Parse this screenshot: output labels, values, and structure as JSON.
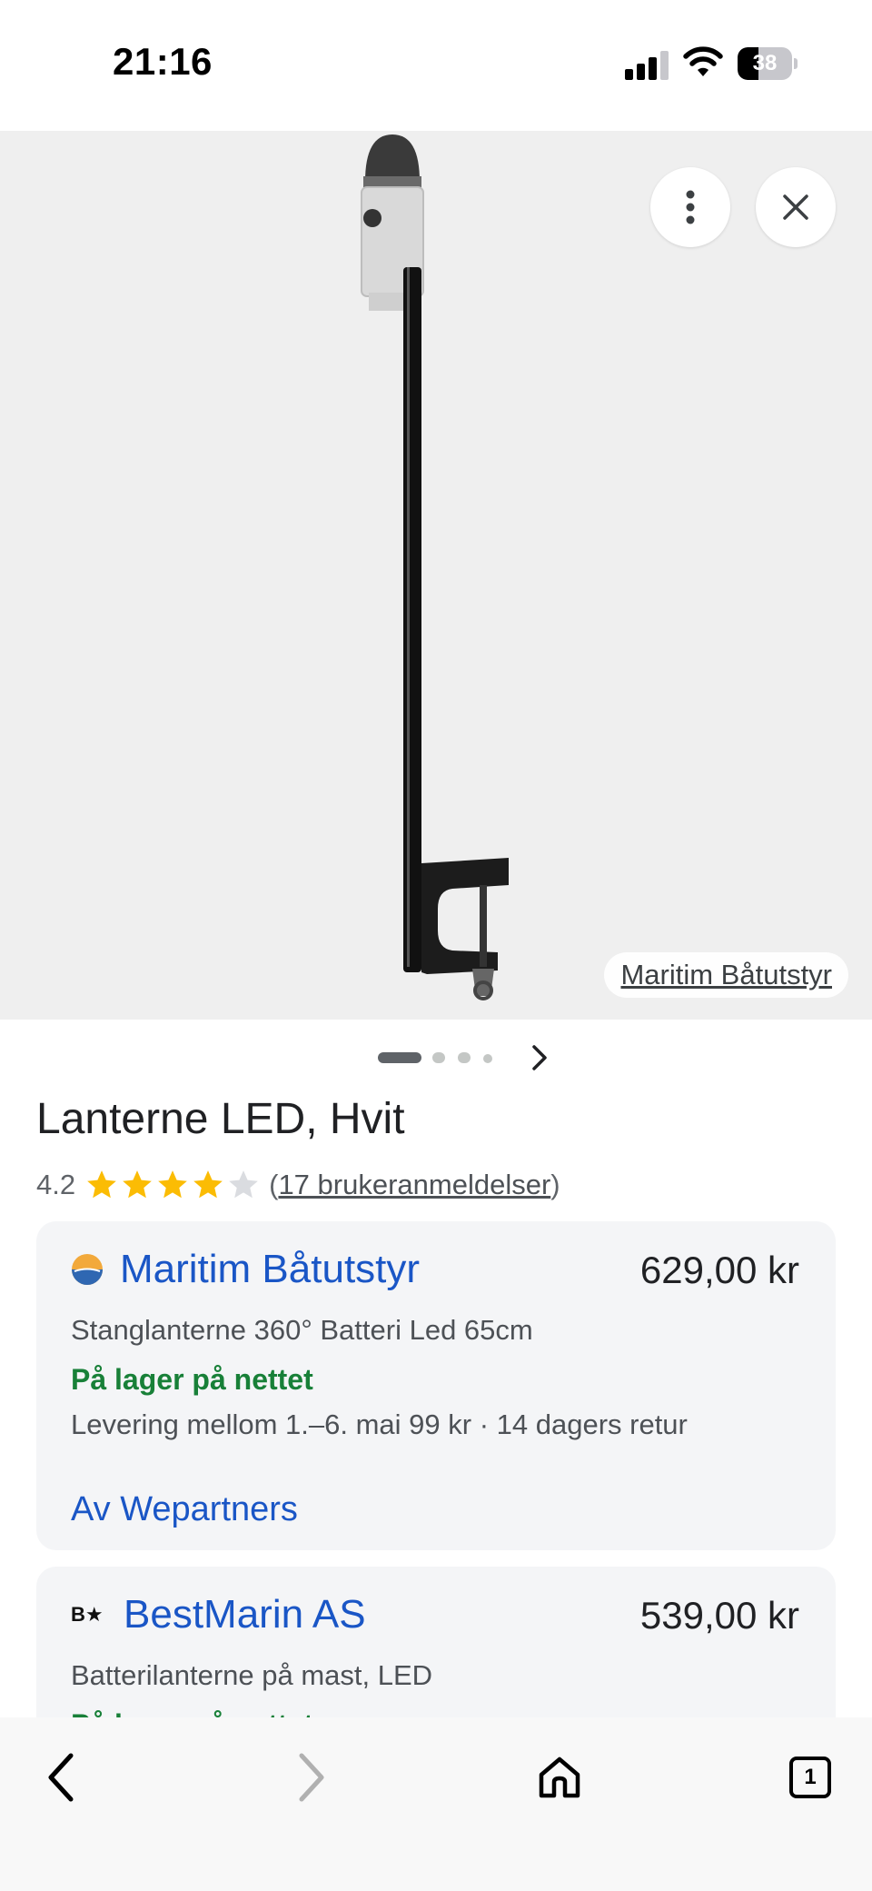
{
  "status_bar": {
    "time": "21:16",
    "battery": "38",
    "battery_level_percent": 38
  },
  "image_viewer": {
    "source_label": "Maritim Båtutstyr",
    "carousel_dot_count": 4,
    "carousel_active_index": 0
  },
  "product": {
    "title": "Lanterne LED, Hvit",
    "rating": "4.2",
    "rating_value": 4.2,
    "rating_max": 5,
    "reviews_prefix": "(",
    "reviews_link": "17 brukeranmeldelser",
    "reviews_suffix": ")"
  },
  "offers": [
    {
      "merchant": "Maritim Båtutstyr",
      "price": "629,00 kr",
      "description": "Stanglanterne 360° Batteri Led 65cm",
      "stock": "På lager på nettet",
      "delivery": "Levering mellom 1.–6. mai 99 kr · 14 dagers retur",
      "partner": "Av Wepartners"
    },
    {
      "merchant": "BestMarin AS",
      "logo_text": "B★",
      "price": "539,00 kr",
      "description": "Batterilanterne på mast, LED",
      "stock": "På lager på nettet"
    }
  ],
  "toolbar": {
    "tab_count": "1"
  },
  "colors": {
    "link_blue": "#1a56c6",
    "in_stock_green": "#188038",
    "star_gold": "#fbbc04",
    "star_empty": "#dadce0",
    "image_background": "#efefef",
    "card_background": "#f4f5f7"
  },
  "icons": [
    "cellular-signal-icon",
    "wifi-icon",
    "battery-icon",
    "more-vert-icon",
    "close-icon",
    "chevron-right-icon",
    "back-icon",
    "forward-icon",
    "home-icon",
    "tabs-icon"
  ]
}
